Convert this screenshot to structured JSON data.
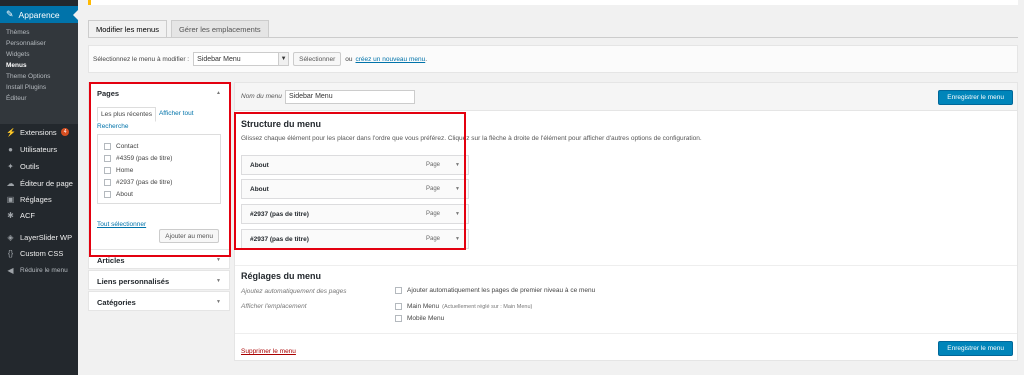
{
  "sidebar": {
    "active": {
      "label": "Apparence",
      "icon": "paintbrush-icon"
    },
    "submenu": [
      "Thèmes",
      "Personnaliser",
      "Widgets",
      "Menus",
      "Theme Options",
      "Install Plugins",
      "Éditeur"
    ],
    "items": [
      {
        "label": "Extensions",
        "icon": "plugin-icon",
        "badge": "4"
      },
      {
        "label": "Utilisateurs",
        "icon": "user-icon"
      },
      {
        "label": "Outils",
        "icon": "wrench-icon"
      },
      {
        "label": "Éditeur de page",
        "icon": "cloud-icon"
      },
      {
        "label": "Réglages",
        "icon": "settings-icon"
      },
      {
        "label": "ACF",
        "icon": "gear-icon"
      },
      {
        "label": "LayerSlider WP",
        "icon": "layers-icon"
      },
      {
        "label": "Custom CSS",
        "icon": "code-icon"
      },
      {
        "label": "Réduire le menu",
        "icon": "collapse-icon"
      }
    ]
  },
  "tabs": [
    "Modifier les menus",
    "Gérer les emplacements"
  ],
  "select_bar": {
    "label": "Sélectionnez le menu à modifier :",
    "selected": "Sidebar Menu",
    "button": "Sélectionner",
    "or_text": "ou",
    "create_link": "créez un nouveau menu",
    "period": "."
  },
  "pages_panel": {
    "title": "Pages",
    "tab_recent": "Les plus récentes",
    "tab_all": "Afficher tout",
    "search": "Recherche",
    "items": [
      "Contact",
      "#4359 (pas de titre)",
      "Home",
      "#2937 (pas de titre)",
      "About"
    ],
    "select_all": "Tout sélectionner",
    "add_button": "Ajouter au menu"
  },
  "other_panels": [
    "Articles",
    "Liens personnalisés",
    "Catégories"
  ],
  "editor": {
    "name_label": "Nom du menu",
    "name_value": "Sidebar Menu",
    "save_button": "Enregistrer le menu",
    "structure_title": "Structure du menu",
    "instructions": "Glissez chaque élément pour les placer dans l'ordre que vous préférez. Cliquez sur la flèche à droite de l'élément pour afficher d'autres options de configuration.",
    "items": [
      {
        "title": "About",
        "type": "Page"
      },
      {
        "title": "About",
        "type": "Page"
      },
      {
        "title": "#2937 (pas de titre)",
        "type": "Page"
      },
      {
        "title": "#2937 (pas de titre)",
        "type": "Page"
      }
    ],
    "settings_title": "Réglages du menu",
    "auto_add_label": "Ajoutez automatiquement des pages",
    "auto_add_option": "Ajouter automatiquement les pages de premier niveau à ce menu",
    "location_label": "Afficher l'emplacement",
    "locations": [
      {
        "label": "Main Menu",
        "note": "(Actuellement réglé sur : Main Menu)"
      },
      {
        "label": "Mobile Menu",
        "note": ""
      }
    ],
    "delete_link": "Supprimer le menu"
  },
  "colors": {
    "highlight": "#e3000f",
    "primary": "#0085ba",
    "sidebar": "#23282d"
  }
}
